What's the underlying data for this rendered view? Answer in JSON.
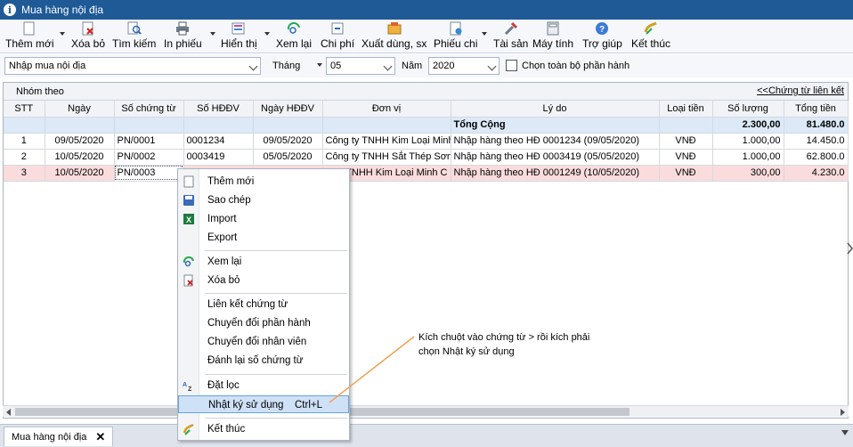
{
  "window": {
    "title": "Mua hàng nội địa"
  },
  "toolbar": {
    "them_moi": "Thêm mới",
    "xoa_bo": "Xóa bỏ",
    "tim_kiem": "Tìm kiếm",
    "in_phieu": "In phiếu",
    "hien_thi": "Hiển thị",
    "xem_lai": "Xem lại",
    "chi_phi": "Chi phí",
    "xuat_dung": "Xuất dùng, sx",
    "phieu_chi": "Phiếu chi",
    "tai_san": "Tài sản",
    "may_tinh": "Máy tính",
    "tro_giup": "Trợ giúp",
    "ket_thuc": "Kết thúc"
  },
  "filter": {
    "module_value": "Nhập mua nội địa",
    "thang_label": "Tháng",
    "thang_value": "05",
    "nam_label": "Năm",
    "nam_value": "2020",
    "chon_toan_bo_label": "Chọn toàn bộ phần hành"
  },
  "grid": {
    "group_label": "Nhóm theo",
    "link_label": "<<Chứng từ liên kết",
    "columns": [
      "STT",
      "Ngày",
      "Số chứng từ",
      "Số HĐĐV",
      "Ngày HĐĐV",
      "Đơn vị",
      "Lý do",
      "Loại tiền",
      "Số lượng",
      "Tổng tiền"
    ],
    "total": {
      "label": "Tổng Cộng",
      "so_luong": "2.300,00",
      "tong_tien": "81.480.0"
    },
    "rows": [
      {
        "stt": "1",
        "ngay": "09/05/2020",
        "so_ct": "PN/0001",
        "so_hd": "0001234",
        "ngay_hd": "09/05/2020",
        "don_vi": "Công ty TNHH Kim Loại Minh C",
        "ly_do": "Nhập hàng theo HĐ 0001234 (09/05/2020)",
        "loai_tien": "VNĐ",
        "so_luong": "1.000,00",
        "tong_tien": "14.450.0"
      },
      {
        "stt": "2",
        "ngay": "10/05/2020",
        "so_ct": "PN/0002",
        "so_hd": "0003419",
        "ngay_hd": "05/05/2020",
        "don_vi": "Công ty TNHH Sắt Thép Sơn H",
        "ly_do": "Nhập hàng theo HĐ 0003419 (05/05/2020)",
        "loai_tien": "VNĐ",
        "so_luong": "1.000,00",
        "tong_tien": "62.800.0"
      },
      {
        "stt": "3",
        "ngay": "10/05/2020",
        "so_ct": "PN/0003",
        "so_hd": "",
        "ngay_hd": "",
        "don_vi": "y TNHH Kim Loại Minh C",
        "ly_do": "Nhập hàng theo HĐ 0001249 (10/05/2020)",
        "loai_tien": "VNĐ",
        "so_luong": "300,00",
        "tong_tien": "4.230.0"
      }
    ]
  },
  "context_menu": {
    "them_moi": "Thêm mới",
    "sao_chep": "Sao chép",
    "import": "Import",
    "export": "Export",
    "xem_lai": "Xem lại",
    "xoa_bo": "Xóa bỏ",
    "lien_ket": "Liên kết chứng từ",
    "chuyen_phan_hanh": "Chuyển đổi phần hành",
    "chuyen_nhan_vien": "Chuyển đổi nhân viên",
    "danh_lai": "Đánh lại số chứng từ",
    "dat_loc": "Đặt lọc",
    "nhat_ky": "Nhật ký sử dụng",
    "nhat_ky_shortcut": "Ctrl+L",
    "ket_thuc": "Kết thúc"
  },
  "annotation": {
    "line1": "Kích chuột vào chứng từ > rồi kích phải",
    "line2": "chọn Nhật ký sử dụng"
  },
  "bottom_tab": {
    "label": "Mua hàng nội địa",
    "close": "✕"
  },
  "colors": {
    "titlebar": "#1f5a97",
    "callout": "#f0a050",
    "selected_row": "#fadcdc",
    "total_row": "#dce9f7"
  }
}
